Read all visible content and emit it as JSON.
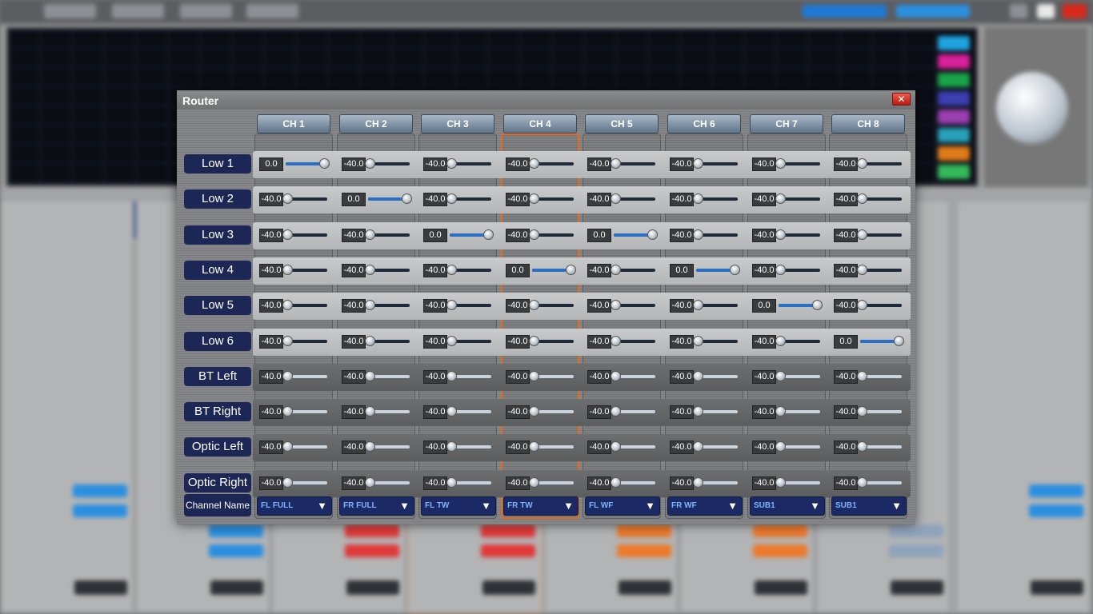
{
  "dialog": {
    "title": "Router",
    "close_label": "✕"
  },
  "columns": [
    {
      "label": "CH 1",
      "name": "FL FULL"
    },
    {
      "label": "CH 2",
      "name": "FR FULL"
    },
    {
      "label": "CH 3",
      "name": "FL TW"
    },
    {
      "label": "CH 4",
      "name": "FR TW"
    },
    {
      "label": "CH 5",
      "name": "FL WF"
    },
    {
      "label": "CH 6",
      "name": "FR WF"
    },
    {
      "label": "CH 7",
      "name": "SUB1"
    },
    {
      "label": "CH 8",
      "name": "SUB1"
    }
  ],
  "selected_column": 3,
  "rows": [
    {
      "label": "Low 1",
      "values": [
        "0.0",
        "-40.0",
        "-40.0",
        "-40.0",
        "-40.0",
        "-40.0",
        "-40.0",
        "-40.0"
      ]
    },
    {
      "label": "Low 2",
      "values": [
        "-40.0",
        "0.0",
        "-40.0",
        "-40.0",
        "-40.0",
        "-40.0",
        "-40.0",
        "-40.0"
      ]
    },
    {
      "label": "Low 3",
      "values": [
        "-40.0",
        "-40.0",
        "0.0",
        "-40.0",
        "0.0",
        "-40.0",
        "-40.0",
        "-40.0"
      ]
    },
    {
      "label": "Low 4",
      "values": [
        "-40.0",
        "-40.0",
        "-40.0",
        "0.0",
        "-40.0",
        "0.0",
        "-40.0",
        "-40.0"
      ]
    },
    {
      "label": "Low 5",
      "values": [
        "-40.0",
        "-40.0",
        "-40.0",
        "-40.0",
        "-40.0",
        "-40.0",
        "0.0",
        "-40.0"
      ]
    },
    {
      "label": "Low 6",
      "values": [
        "-40.0",
        "-40.0",
        "-40.0",
        "-40.0",
        "-40.0",
        "-40.0",
        "-40.0",
        "0.0"
      ]
    },
    {
      "label": "BT Left",
      "values": [
        "-40.0",
        "-40.0",
        "-40.0",
        "-40.0",
        "-40.0",
        "-40.0",
        "-40.0",
        "-40.0"
      ]
    },
    {
      "label": "BT Right",
      "values": [
        "-40.0",
        "-40.0",
        "-40.0",
        "-40.0",
        "-40.0",
        "-40.0",
        "-40.0",
        "-40.0"
      ]
    },
    {
      "label": "Optic Left",
      "values": [
        "-40.0",
        "-40.0",
        "-40.0",
        "-40.0",
        "-40.0",
        "-40.0",
        "-40.0",
        "-40.0"
      ]
    },
    {
      "label": "Optic Right",
      "values": [
        "-40.0",
        "-40.0",
        "-40.0",
        "-40.0",
        "-40.0",
        "-40.0",
        "-40.0",
        "-40.0"
      ]
    }
  ],
  "channel_name_label": "Channel Name",
  "slider_range": [
    -40,
    0
  ],
  "colors": {
    "accent_selected": "#e56b1f",
    "label_bg": "#1c2755",
    "select_text": "#7fb2ff",
    "close_red": "#d9291c"
  }
}
